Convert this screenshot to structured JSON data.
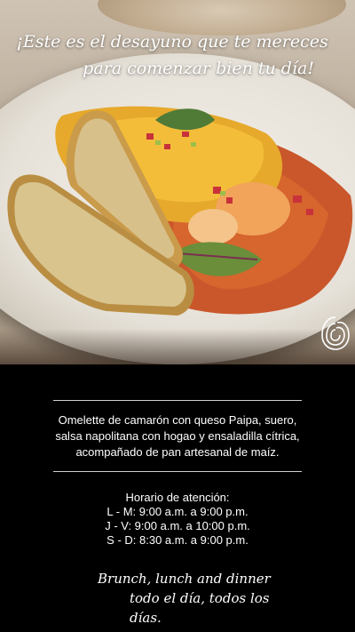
{
  "hero": {
    "headline_line1": "¡Este es el desayuno que te mereces",
    "headline_line2": "para comenzar bien tu día!"
  },
  "description": {
    "lines": [
      "Omelette de camarón con queso Paipa, suero,",
      "salsa napolitana con hogao y ensaladilla cítrica,",
      "acompañado de pan artesanal de maíz."
    ]
  },
  "hours": {
    "title": "Horario de atención:",
    "rows": [
      "L - M: 9:00 a.m. a 9:00 p.m.",
      "J - V: 9:00 a.m. a 10:00 p.m.",
      "S - D: 8:30 a.m. a 9:00 p.m."
    ]
  },
  "tagline": {
    "line1": "Brunch, lunch and dinner",
    "line2": "todo el día, todos los días."
  },
  "colors": {
    "panel_bg": "#000000",
    "text": "#ffffff",
    "divider": "#cfcfcf"
  },
  "icons": {
    "brand": "spiral-logo-icon"
  }
}
